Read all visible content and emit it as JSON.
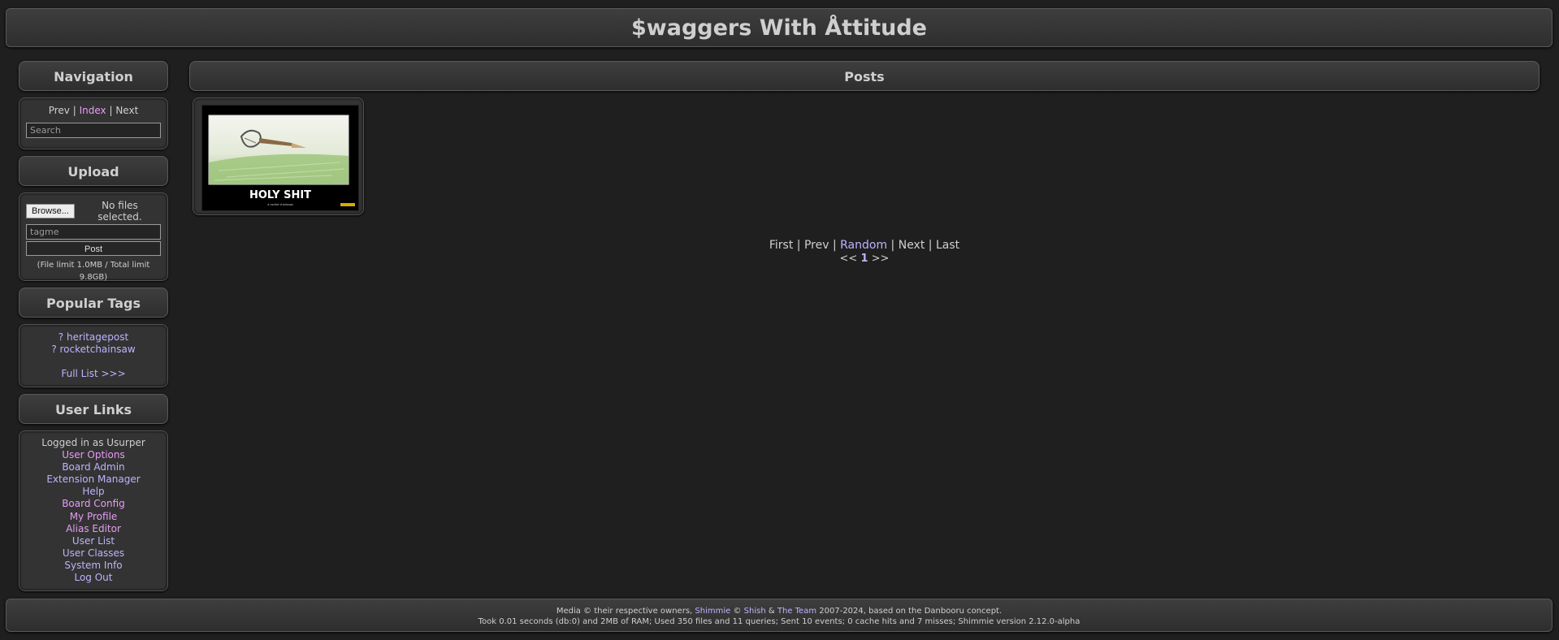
{
  "site_title": "$waggers With Åttitude",
  "navigation": {
    "heading": "Navigation",
    "prev": "Prev",
    "index": "Index",
    "next": "Next",
    "sep": "|",
    "search_placeholder": "Search"
  },
  "upload": {
    "heading": "Upload",
    "browse_label": "Browse...",
    "file_status": "No files selected.",
    "tags_placeholder": "tagme",
    "post_label": "Post",
    "limit_text": "(File limit 1.0MB / Total limit 9.8GB)"
  },
  "popular_tags": {
    "heading": "Popular Tags",
    "tags": [
      "? heritagepost",
      "? rocketchainsaw"
    ],
    "full_list": "Full List >>>"
  },
  "user_links": {
    "heading": "User Links",
    "logged_in": "Logged in as Usurper",
    "links": [
      "User Options",
      "Board Admin",
      "Extension Manager",
      "Help",
      "Board Config",
      "My Profile",
      "Alias Editor",
      "User List",
      "User Classes",
      "System Info",
      "Log Out"
    ]
  },
  "posts": {
    "heading": "Posts",
    "thumb_caption": "HOLY SHIT",
    "thumb_subcaption": "a rocket chainsaw"
  },
  "paginator": {
    "first": "First",
    "prev": "Prev",
    "random": "Random",
    "next": "Next",
    "last": "Last",
    "sep": "|",
    "prev_page": "<<",
    "current_page": "1",
    "next_page": ">>"
  },
  "footer": {
    "line1_a": "Media © their respective owners,",
    "shimmie": "Shimmie",
    "copy": "©",
    "shish": "Shish",
    "amp": "&",
    "team": "The Team",
    "line1_b": "2007-2024, based on the Danbooru concept.",
    "line2": "Took 0.01 seconds (db:0) and 2MB of RAM; Used 350 files and 11 queries; Sent 10 events; 0 cache hits and 7 misses; Shimmie version 2.12.0-alpha"
  },
  "colors": {
    "background": "#1f1f1f",
    "link": "#bdb4ff",
    "link_visited": "#e79cf6"
  }
}
